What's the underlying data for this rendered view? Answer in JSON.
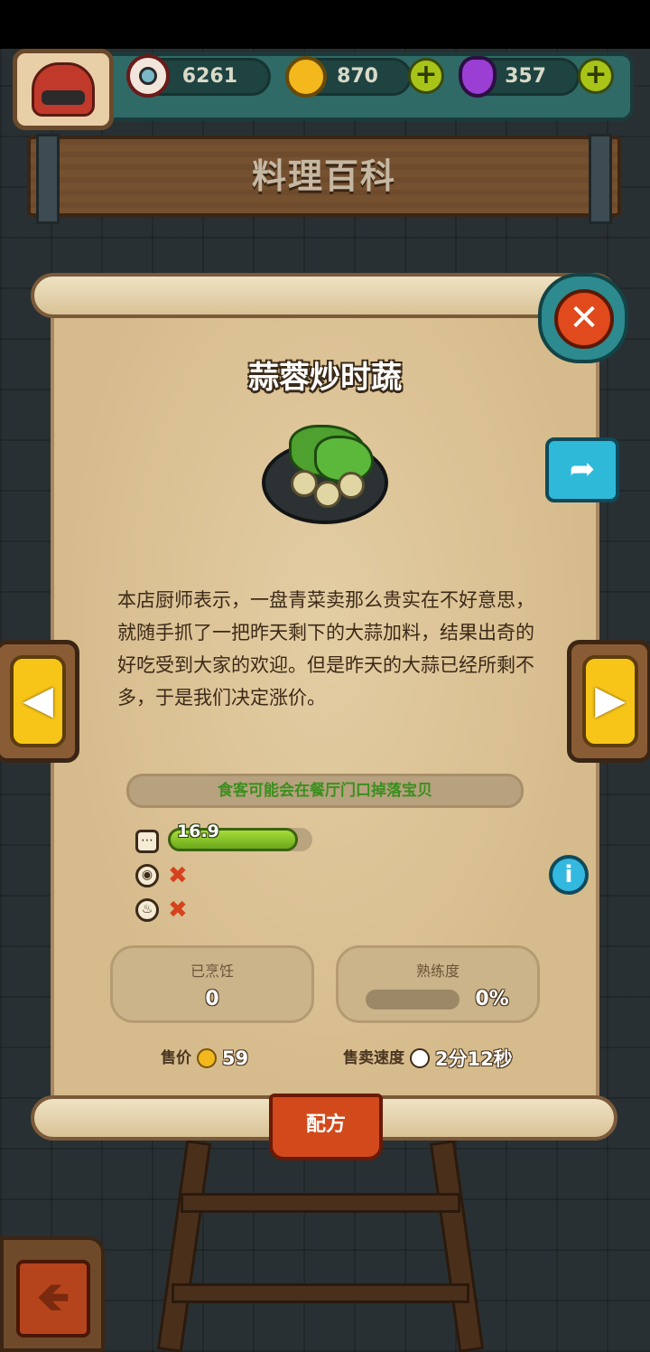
{
  "resources": {
    "eyeballs": "6261",
    "coins": "870",
    "potions": "357"
  },
  "page_title": "料理百科",
  "dish": {
    "name": "蒜蓉炒时蔬",
    "description": "本店厨师表示，一盘青菜卖那么贵实在不好意思，就随手抓了一把昨天剩下的大蒜加料，结果出奇的好吃受到大家的欢迎。但是昨天的大蒜已经所剩不多，于是我们决定涨价。",
    "drop_hint": "食客可能会在餐厅门口掉落宝贝",
    "stat_value": "16.9",
    "stat_fill": 0.9,
    "cooked_label": "已烹饪",
    "cooked_count": "0",
    "proficiency_label": "熟练度",
    "proficiency": "0%",
    "price_label": "售价",
    "price": "59",
    "speed_label": "售卖速度",
    "speed": "2分12秒",
    "recipe_button": "配方"
  },
  "icons": {
    "close": "close-icon",
    "share": "share-icon",
    "info": "info-icon",
    "prev": "chevron-left-icon",
    "next": "chevron-right-icon",
    "back": "back-arrow-icon"
  },
  "colors": {
    "accent_green": "#3b8f1e",
    "close_red": "#e04a1c",
    "arrow_yellow": "#f6c518",
    "info_blue": "#33b8e0"
  }
}
